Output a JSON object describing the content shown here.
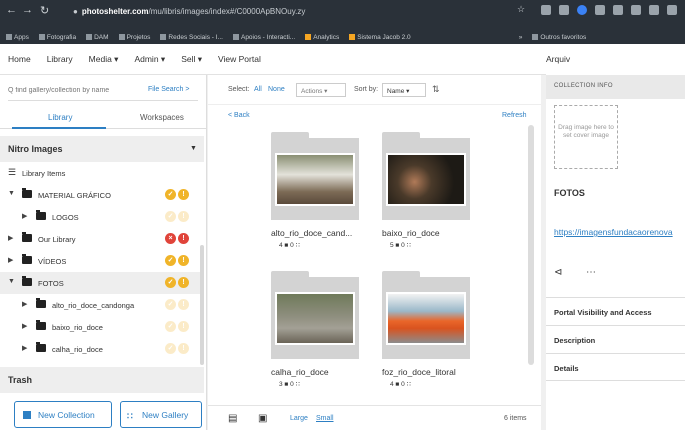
{
  "browser": {
    "url_host": "photoshelter.com",
    "url_path": "/mu/libris/images/index#/C0000ApBNOuy.zy",
    "bookmarks": [
      "Apps",
      "Fotografia",
      "DAM",
      "Projetos",
      "Redes Sociais - I...",
      "Apoios - Interacti...",
      "Analytics",
      "Sistema Jacob 2.0",
      "Outros favoritos"
    ],
    "more_label": "»"
  },
  "menu": {
    "items": [
      "Home",
      "Library",
      "Media ▾",
      "Admin ▾",
      "Sell ▾",
      "View Portal"
    ],
    "right": "Arquiv"
  },
  "sidebar": {
    "search_placeholder": "Q find gallery/collection by name",
    "research_link": "File Search >",
    "tab_library": "Library",
    "tab_workspaces": "Workspaces",
    "group_title": "Nitro Images",
    "tree": [
      {
        "label": "Library Items"
      },
      {
        "label": "MATERIAL GRÁFICO"
      },
      {
        "label": "LOGOS"
      },
      {
        "label": "Our Library"
      },
      {
        "label": "VÍDEOS"
      },
      {
        "label": "FOTOS"
      },
      {
        "label": "alto_rio_doce_candonga"
      },
      {
        "label": "baixo_rio_doce"
      },
      {
        "label": "calha_rio_doce"
      }
    ],
    "trash": "Trash",
    "new_collection": "New Collection",
    "new_gallery": "New Gallery"
  },
  "toolbar": {
    "select_label": "Select:",
    "select_all": "All",
    "select_none": "None",
    "actions": "Actions ▾",
    "sort_label": "Sort by:",
    "sort_value": "Name",
    "back": "< Back",
    "refresh": "Refresh"
  },
  "galleries": [
    {
      "name": "alto_rio_doce_cand...",
      "meta": "4 ■ 0 ∷"
    },
    {
      "name": "baixo_rio_doce",
      "meta": "5 ■ 0 ∷"
    },
    {
      "name": "calha_rio_doce",
      "meta": "3 ■ 0 ∷"
    },
    {
      "name": "foz_rio_doce_litoral",
      "meta": "4 ■ 0 ∷"
    }
  ],
  "bottom": {
    "large": "Large",
    "small": "Small",
    "count": "6 items"
  },
  "info": {
    "header": "COLLECTION INFO",
    "drag_text": "Drag image here to set cover image",
    "title": "FOTOS",
    "url": "https://imagensfundacaorenova",
    "sections": [
      "Portal Visibility and Access",
      "Description",
      "Details"
    ]
  },
  "colors": {
    "accent": "#2d7fc3",
    "badge_yellow": "#f0b429",
    "badge_red": "#e0443a"
  }
}
